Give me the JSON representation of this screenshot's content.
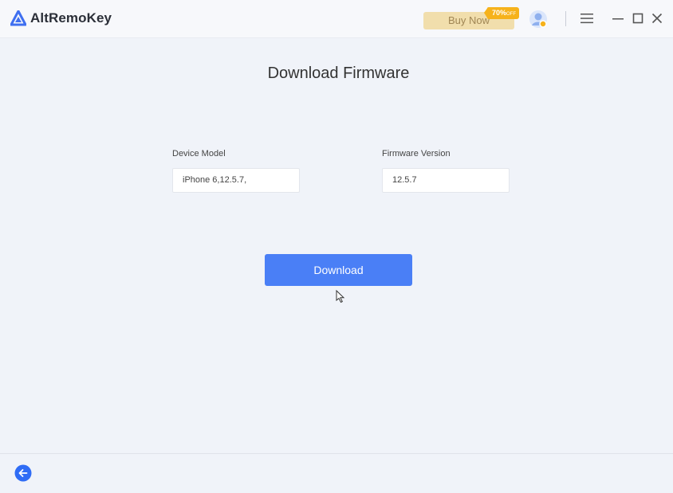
{
  "app": {
    "title": "AltRemoKey",
    "logo_icon": "altremokey-logo-icon",
    "brand_color": "#3f6ff0"
  },
  "header": {
    "buy_now_label": "Buy Now",
    "discount_badge": "70%",
    "discount_suffix": "OFF",
    "icons": [
      "avatar-icon",
      "menu-icon",
      "minimize-icon",
      "maximize-icon",
      "close-icon"
    ]
  },
  "main": {
    "page_title": "Download Firmware",
    "device_model": {
      "label": "Device Model",
      "value": "iPhone 6,12.5.7,"
    },
    "firmware_version": {
      "label": "Firmware Version",
      "value": "12.5.7"
    },
    "download_label": "Download",
    "accent_color": "#4a7ff6"
  },
  "footer": {
    "back_icon": "back-arrow-icon"
  }
}
